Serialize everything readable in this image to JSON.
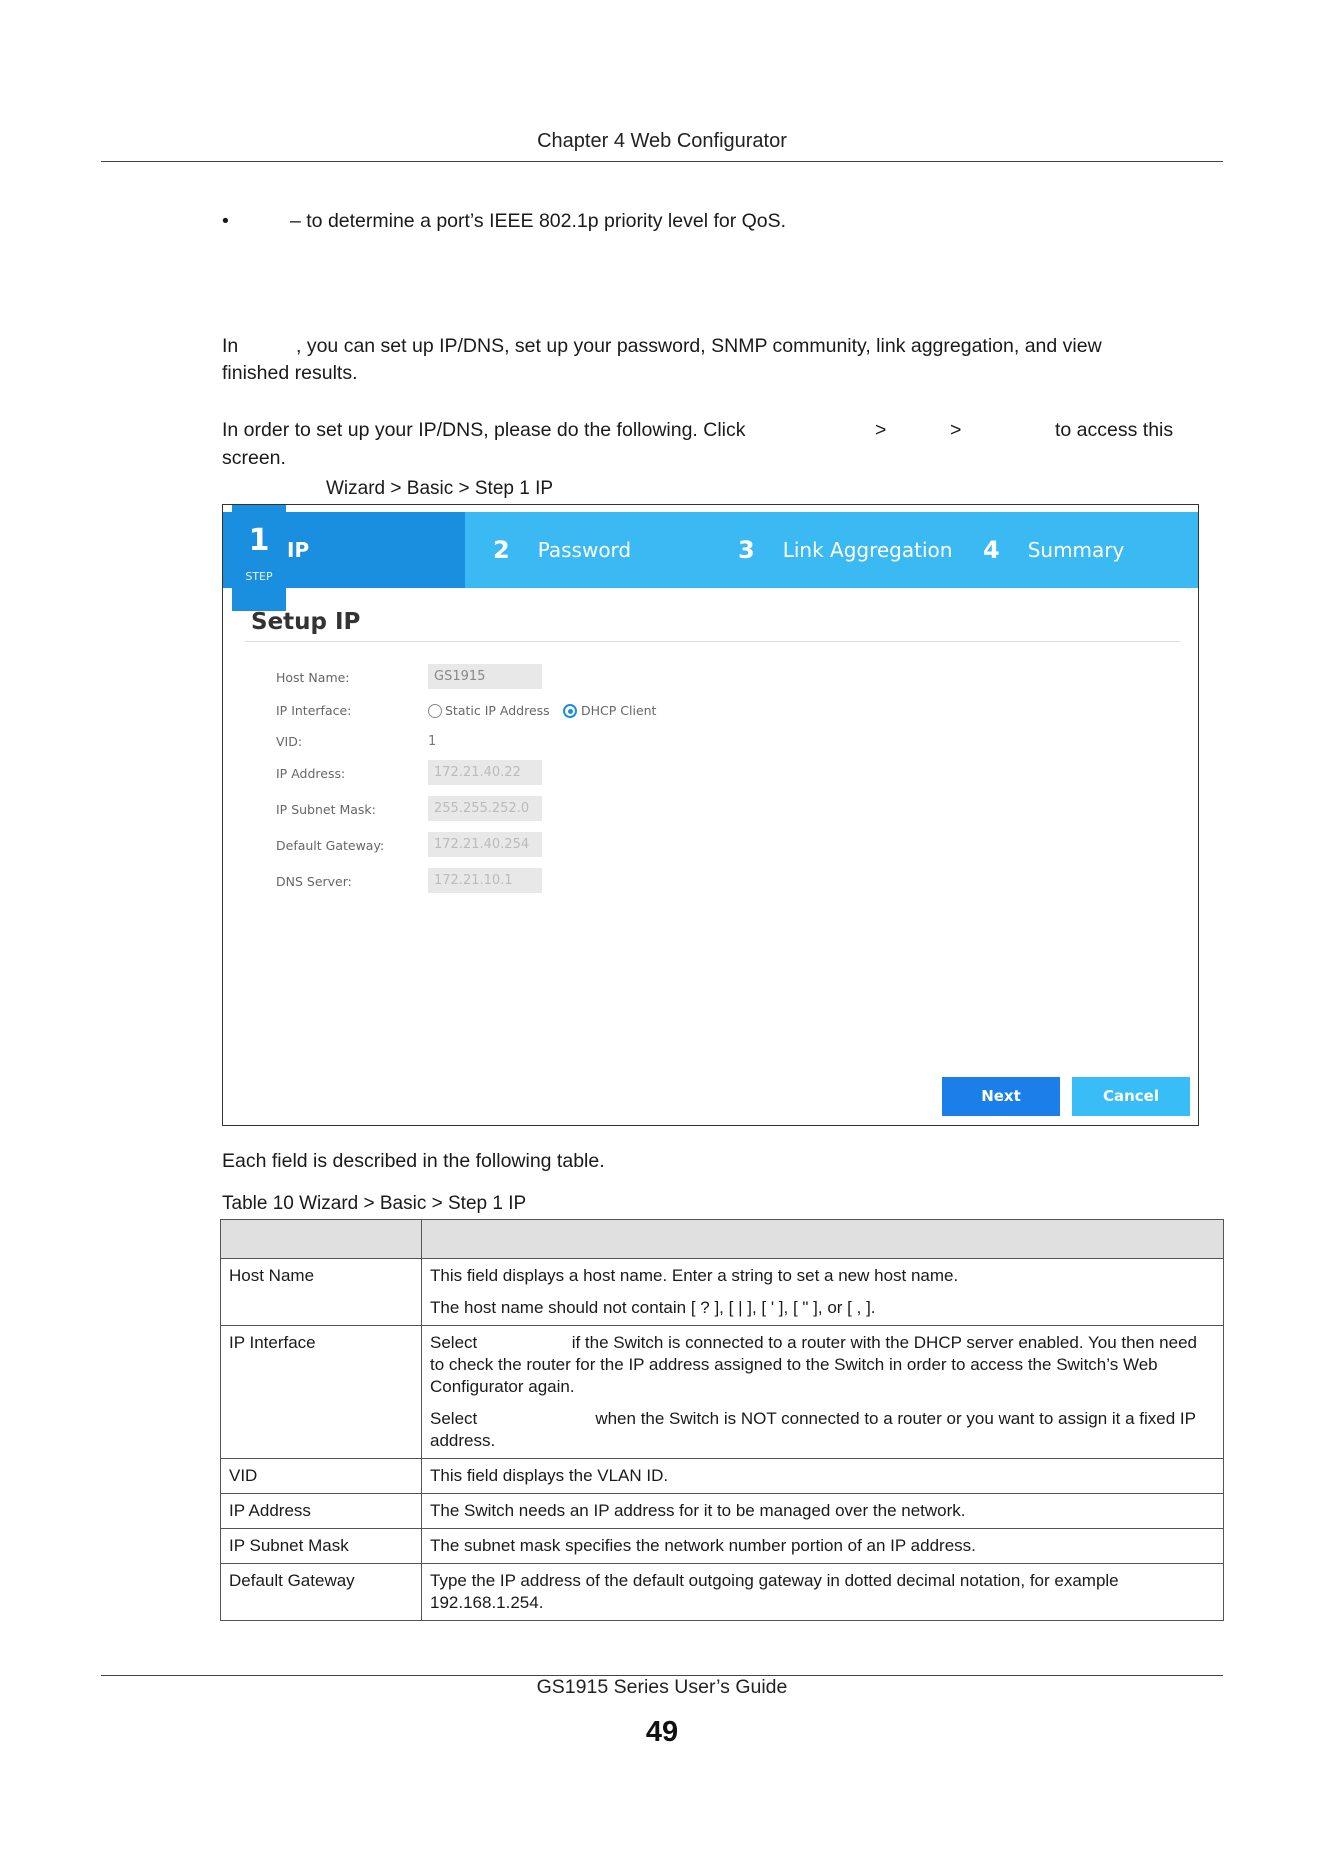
{
  "header": {
    "chapter": "Chapter 4 Web Configurator"
  },
  "intro": {
    "bullet_symbol": "•",
    "bullet_text": "– to determine a port’s IEEE 802.1p priority level for QoS.",
    "para1_a": "In",
    "para1_b": ", you can set up IP/DNS, set up your password, SNMP community, link aggregation, and view",
    "para1_c": "finished results.",
    "para2_a": "In order to set up your IP/DNS, please do the following. Click",
    "para2_gt1": ">",
    "para2_gt2": ">",
    "para2_b": "to access this",
    "para2_c": "screen.",
    "figure_caption": "Wizard > Basic > Step 1 IP"
  },
  "screenshot": {
    "step_badge_number": "1",
    "step_badge_label": "STEP",
    "steps": [
      {
        "num": "",
        "label": "IP"
      },
      {
        "num": "2",
        "label": "Password"
      },
      {
        "num": "3",
        "label": "Link Aggregation"
      },
      {
        "num": "4",
        "label": "Summary"
      }
    ],
    "title": "Setup IP",
    "fields": {
      "host_name_label": "Host Name:",
      "host_name_value": "GS1915",
      "ip_interface_label": "IP Interface:",
      "static_label": "Static IP Address",
      "dhcp_label": "DHCP Client",
      "vid_label": "VID:",
      "vid_value": "1",
      "ip_address_label": "IP Address:",
      "ip_address_value": "172.21.40.22",
      "subnet_label": "IP Subnet Mask:",
      "subnet_value": "255.255.252.0",
      "gateway_label": "Default Gateway:",
      "gateway_value": "172.21.40.254",
      "dns_label": "DNS Server:",
      "dns_value": "172.21.10.1"
    },
    "next_label": "Next",
    "cancel_label": "Cancel"
  },
  "table_intro": "Each field is described in the following table.",
  "table_caption": "Table 10   Wizard > Basic > Step 1 IP",
  "table": {
    "rows": [
      {
        "label": "Host Name",
        "desc1": "This field displays a host name. Enter a string to set a new host name.",
        "desc2": "The host name should not contain [ ? ], [ | ], [ ' ], [ \" ], or [ , ]."
      },
      {
        "label": "IP Interface",
        "desc1": "Select                    if the Switch is connected to a router with the DHCP server enabled. You then need to check the router for the IP address assigned to the Switch in order to access the Switch’s Web Configurator again.",
        "desc2": "Select                         when the Switch is NOT connected to a router or you want to assign it a fixed IP address."
      },
      {
        "label": "VID",
        "desc1": "This field displays the VLAN ID."
      },
      {
        "label": "IP Address",
        "desc1": "The Switch needs an IP address for it to be managed over the network."
      },
      {
        "label": "IP Subnet Mask",
        "desc1": "The subnet mask specifies the network number portion of an IP address."
      },
      {
        "label": "Default Gateway",
        "desc1": "Type the IP address of the default outgoing gateway in dotted decimal notation, for example 192.168.1.254."
      }
    ]
  },
  "footer": {
    "guide": "GS1915 Series User’s Guide",
    "page": "49"
  }
}
